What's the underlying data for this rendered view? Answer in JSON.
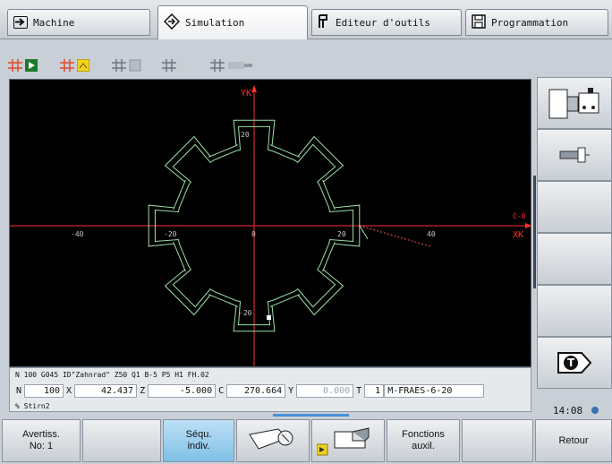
{
  "tabs": [
    {
      "label": "Machine",
      "icon": "arrow-right-box-icon"
    },
    {
      "label": "Simulation",
      "icon": "diamond-arrow-icon"
    },
    {
      "label": "Editeur d'outils",
      "icon": "tool-holder-icon"
    },
    {
      "label": "Programmation",
      "icon": "disk-icon"
    }
  ],
  "active_tab": "Simulation",
  "viewport": {
    "axis_y_label": "YK",
    "axis_x_label": "XK",
    "c_label": "C-0",
    "x_ticks": [
      "-40",
      "-20",
      "0",
      "20",
      "40"
    ],
    "y_ticks": [
      "20",
      "-20"
    ]
  },
  "status": {
    "line1": "N 100   G045 ID\"Zahnrad\" Z50 Q1 B-5 P5 H1 FH.02",
    "n_label": "N",
    "n_value": "100",
    "x_label": "X",
    "x_value": "42.437",
    "z_label": "Z",
    "z_value": "-5.000",
    "c_label": "C",
    "c_value": "270.664",
    "y_label": "Y",
    "y_value": "0.000",
    "t_label": "T",
    "t_value": "1",
    "tool_name": "M-FRAES-6-20",
    "line3": "% Stirn2"
  },
  "softkeys": {
    "warnings_line1": "Avertiss.",
    "warnings_line2": "No: 1",
    "single_block_line1": "Séqu.",
    "single_block_line2": "indiv.",
    "aux_line1": "Fonctions",
    "aux_line2": "auxil.",
    "back": "Retour"
  },
  "clock": "14:08",
  "colors": {
    "accent": "#7fc0e6",
    "contour": "#9ee0a8",
    "axis_y": "#ff3030",
    "axis_x": "#ff3030"
  }
}
